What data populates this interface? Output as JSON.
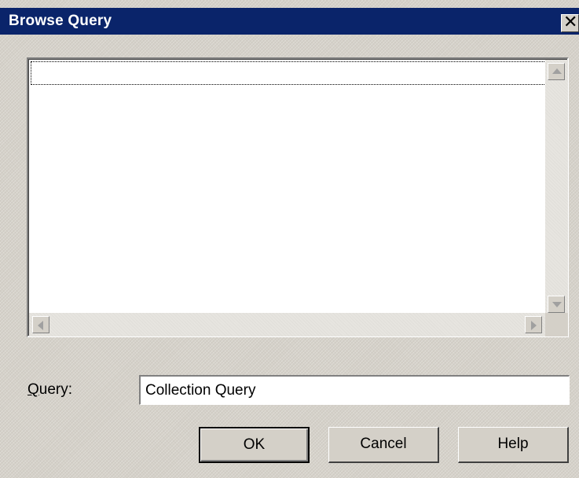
{
  "window": {
    "title": "Browse Query",
    "close_glyph": "✕"
  },
  "listbox": {
    "items": []
  },
  "query": {
    "label": "Query:",
    "label_mnemonic": "Q",
    "label_rest": "uery:",
    "value": "Collection Query"
  },
  "buttons": {
    "ok": "OK",
    "cancel": "Cancel",
    "help": "Help"
  },
  "icons": {
    "close": "close-icon",
    "scroll_up": "chevron-up-icon",
    "scroll_down": "chevron-down-icon",
    "scroll_left": "chevron-left-icon",
    "scroll_right": "chevron-right-icon"
  },
  "colors": {
    "titlebar": "#0a246a",
    "dialog_bg": "#d4d0c8"
  }
}
